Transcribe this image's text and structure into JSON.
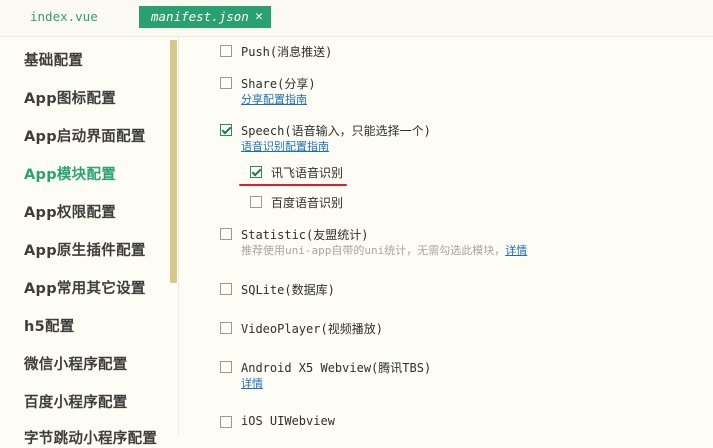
{
  "tabs": [
    {
      "label": "index.vue",
      "active": false
    },
    {
      "label": "manifest.json",
      "active": true,
      "close": "✕"
    }
  ],
  "sidebar": {
    "items": [
      {
        "label": "基础配置",
        "active": false
      },
      {
        "label": "App图标配置",
        "active": false
      },
      {
        "label": "App启动界面配置",
        "active": false
      },
      {
        "label": "App模块配置",
        "active": true
      },
      {
        "label": "App权限配置",
        "active": false
      },
      {
        "label": "App原生插件配置",
        "active": false
      },
      {
        "label": "App常用其它设置",
        "active": false
      },
      {
        "label": "h5配置",
        "active": false
      },
      {
        "label": "微信小程序配置",
        "active": false
      },
      {
        "label": "百度小程序配置",
        "active": false
      },
      {
        "label": "字节跳动小程序配置",
        "active": false
      }
    ]
  },
  "modules": {
    "push": {
      "label": "Push(消息推送)",
      "checked": false
    },
    "share": {
      "label": "Share(分享)",
      "checked": false,
      "link": "分享配置指南"
    },
    "speech": {
      "label": "Speech(语音输入，只能选择一个)",
      "checked": true,
      "link": "语音识别配置指南"
    },
    "speech_xunfei": {
      "label": "讯飞语音识别",
      "checked": true
    },
    "speech_baidu": {
      "label": "百度语音识别",
      "checked": false
    },
    "statistic": {
      "label": "Statistic(友盟统计)",
      "checked": false,
      "hint": "推荐使用uni-app自带的uni统计，无需勾选此模块，",
      "link": "详情"
    },
    "sqlite": {
      "label": "SQLite(数据库)",
      "checked": false
    },
    "videoplayer": {
      "label": "VideoPlayer(视频播放)",
      "checked": false
    },
    "x5": {
      "label": "Android X5 Webview(腾讯TBS)",
      "checked": false,
      "link": "详情"
    },
    "uiwebview": {
      "label": "iOS UIWebview",
      "checked": false
    }
  },
  "colors": {
    "accent": "#28a070",
    "link": "#1f6fb8",
    "annotation": "#e8182a"
  }
}
